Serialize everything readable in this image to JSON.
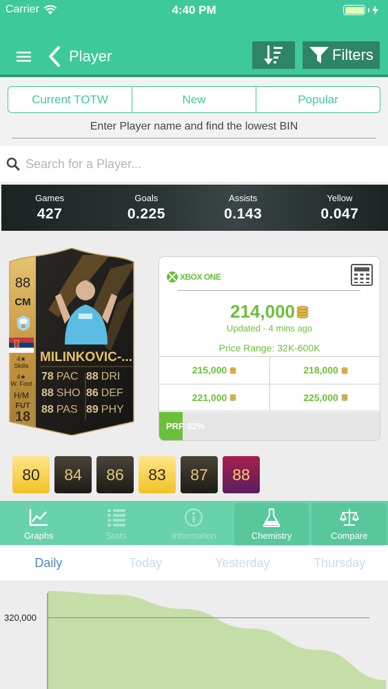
{
  "status_bar": {
    "carrier": "Carrier",
    "time": "4:40 PM"
  },
  "navbar": {
    "title": "Player",
    "filters_label": "Filters"
  },
  "segments": [
    "Current TOTW",
    "New",
    "Popular"
  ],
  "hint": "Enter Player name and find the lowest BIN",
  "search": {
    "placeholder": "Search for a Player..."
  },
  "stats": [
    {
      "label": "Games",
      "value": "427"
    },
    {
      "label": "Goals",
      "value": "0.225"
    },
    {
      "label": "Assists",
      "value": "0.143"
    },
    {
      "label": "Yellow",
      "value": "0.047"
    }
  ],
  "card": {
    "rating": "88",
    "position": "CM",
    "name": "MILINKOVIC-...",
    "skills_stars": "4★",
    "skills_label": "Skills",
    "weak_foot_stars": "4★",
    "weak_foot_label": "W. Foot",
    "work_rate": "H/M",
    "fut_label": "FUT",
    "fut_year": "18",
    "attributes": [
      {
        "value": "78",
        "label": "PAC"
      },
      {
        "value": "88",
        "label": "DRI"
      },
      {
        "value": "88",
        "label": "SHO"
      },
      {
        "value": "86",
        "label": "DEF"
      },
      {
        "value": "88",
        "label": "PAS"
      },
      {
        "value": "89",
        "label": "PHY"
      }
    ]
  },
  "price_panel": {
    "platform": "XBOX ONE",
    "price": "214,000",
    "updated": "Updated - 4 mins ago",
    "range": "Price Range: 32K-600K",
    "other_prices": [
      "215,000",
      "218,000",
      "221,000",
      "225,000"
    ],
    "prp_label": "PRP 32%",
    "prp_percent": 32
  },
  "versions": [
    {
      "value": "80",
      "style": "gold"
    },
    {
      "value": "84",
      "style": "black"
    },
    {
      "value": "86",
      "style": "black"
    },
    {
      "value": "83",
      "style": "gold"
    },
    {
      "value": "87",
      "style": "black"
    },
    {
      "value": "88",
      "style": "purple"
    }
  ],
  "tabs": [
    {
      "label": "Graphs",
      "icon": "chart-line-icon"
    },
    {
      "label": "Stats",
      "icon": "list-icon"
    },
    {
      "label": "Information",
      "icon": "info-icon"
    },
    {
      "label": "Chemistry",
      "icon": "flask-icon"
    },
    {
      "label": "Compare",
      "icon": "scale-icon"
    }
  ],
  "periods": [
    "Daily",
    "Today",
    "Yesterday",
    "Thursday"
  ],
  "chart_data": {
    "type": "area",
    "title": "",
    "xlabel": "",
    "ylabel": "",
    "y_tick_labels": [
      "320,000"
    ],
    "x": [
      0,
      1,
      2,
      3,
      4,
      5
    ],
    "series": [
      {
        "values": [
          335000,
          333000,
          325000,
          314000,
          302000,
          285000
        ]
      }
    ],
    "ylim": [
      280000,
      340000
    ],
    "colors": {
      "fill": "#c5dea8",
      "grid": "#8a8a8a"
    }
  },
  "colors": {
    "brand": "#3ec99b",
    "dark_brand": "#2e8467",
    "price_green": "#6bbf3a",
    "active_period": "#4e88c0"
  }
}
